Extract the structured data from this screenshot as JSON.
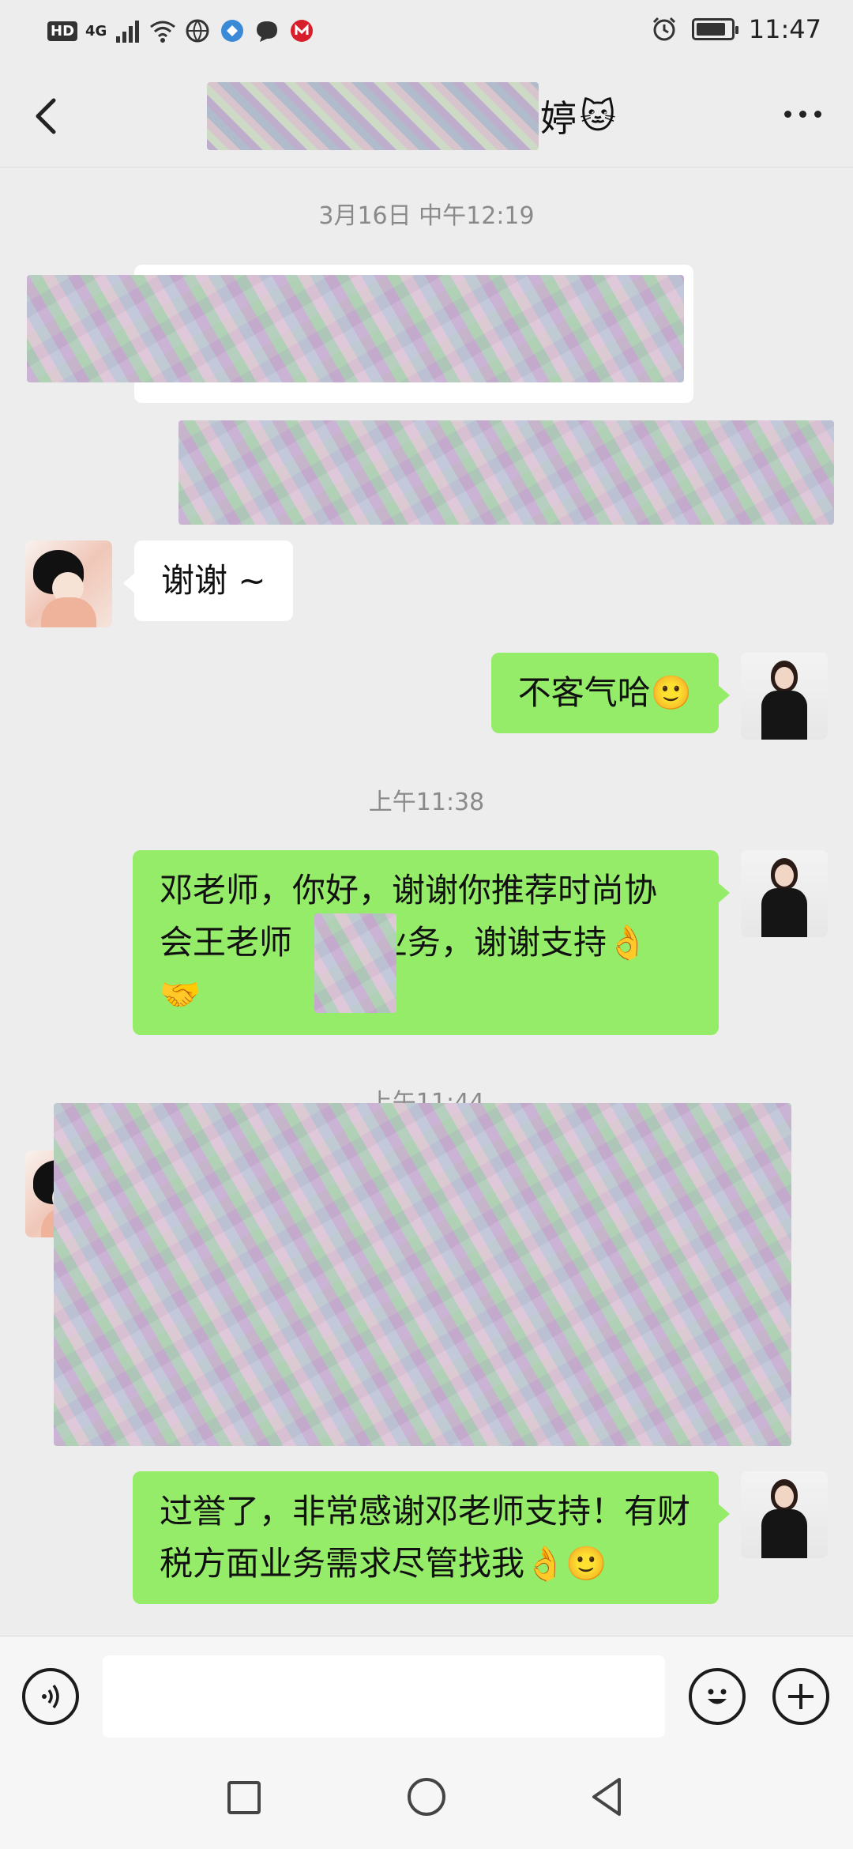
{
  "status_bar": {
    "network_badge": "HD",
    "network_type": "4G",
    "time": "11:47",
    "battery_level": 0.85
  },
  "header": {
    "title_visible_char": "婷",
    "title_emoji": "🐱"
  },
  "messages": {
    "timestamp1": "3月16日 中午12:19",
    "msg_thanks": "谢谢 ~",
    "msg_welcome": "不客气哈🙂",
    "timestamp2": "上午11:38",
    "msg_long_line1": "邓老师，你好，谢谢你推荐时尚协",
    "msg_long_line2_a": "会王老师",
    "msg_long_line2_b": "业务，谢谢支持👌",
    "msg_long_line3": "🤝",
    "timestamp3": "上午11:44",
    "msg_last": "过誉了，非常感谢邓老师支持！有财税方面业务需求尽管找我👌🙂"
  },
  "input": {
    "placeholder": ""
  },
  "colors": {
    "background": "#ededed",
    "bubble_right": "#95ec69",
    "bubble_left": "#ffffff"
  }
}
